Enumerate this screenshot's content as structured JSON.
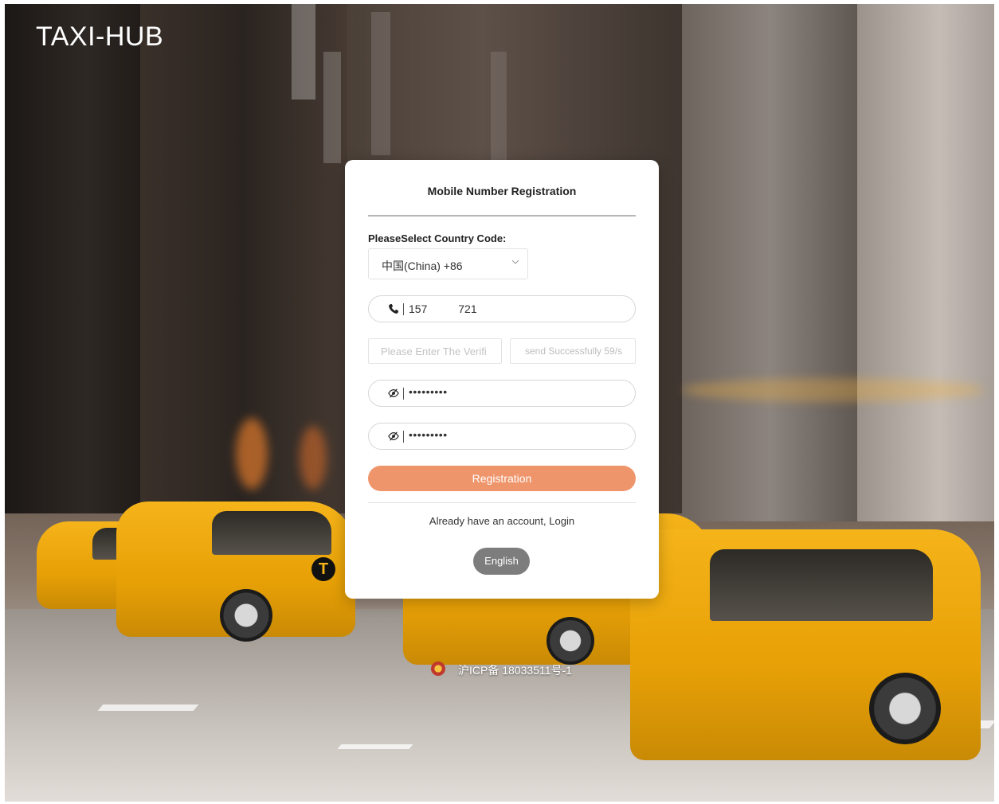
{
  "brand": {
    "logo_text": "TAXI-HUB"
  },
  "form": {
    "title": "Mobile Number Registration",
    "country_code_label": "PleaseSelect Country Code:",
    "country_code_value": "中国(China)  +86",
    "phone_value": "157          721",
    "verification_placeholder": "Please Enter The Verifi",
    "send_status": "send Successfully 59/s",
    "password_value": "•••••••••",
    "confirm_password_value": "•••••••••",
    "register_label": "Registration",
    "login_prompt": "Already have an account,",
    "login_link": "Login",
    "language_label": "English"
  },
  "footer": {
    "icp_text": "沪ICP备 18033511号-1"
  },
  "colors": {
    "register_button": "#ef956b",
    "language_button": "#7d7d7d",
    "card_background": "#ffffff"
  },
  "icons": [
    "phone-icon",
    "eye-slash-icon",
    "chevron-down-icon",
    "police-emblem-icon"
  ]
}
